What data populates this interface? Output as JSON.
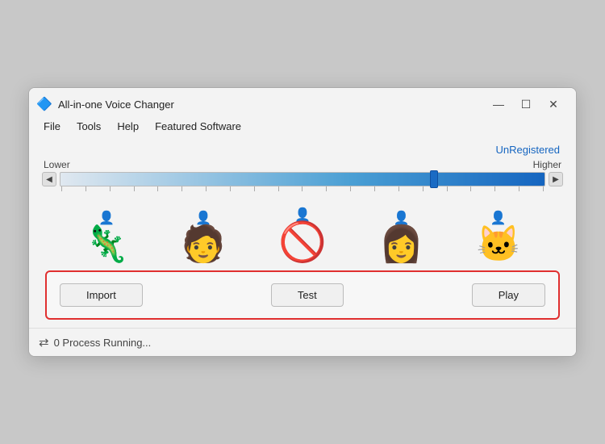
{
  "window": {
    "title": "All-in-one Voice Changer",
    "icon": "🔷",
    "controls": {
      "minimize": "—",
      "maximize": "☐",
      "close": "✕"
    }
  },
  "menubar": {
    "items": [
      "File",
      "Tools",
      "Help",
      "Featured Software"
    ]
  },
  "header": {
    "unregistered_label": "UnRegistered"
  },
  "pitch": {
    "lower_label": "Lower",
    "higher_label": "Higher"
  },
  "avatars": [
    {
      "emoji": "🦎",
      "alt": "dragon"
    },
    {
      "emoji": "👦",
      "alt": "boy"
    },
    {
      "emoji": "🚫",
      "alt": "no-entry"
    },
    {
      "emoji": "👩",
      "alt": "girl-glasses"
    },
    {
      "emoji": "🐱",
      "alt": "cat"
    }
  ],
  "actions": {
    "import_label": "Import",
    "test_label": "Test",
    "play_label": "Play"
  },
  "status": {
    "icon": "⇄",
    "text": "0 Process Running..."
  }
}
